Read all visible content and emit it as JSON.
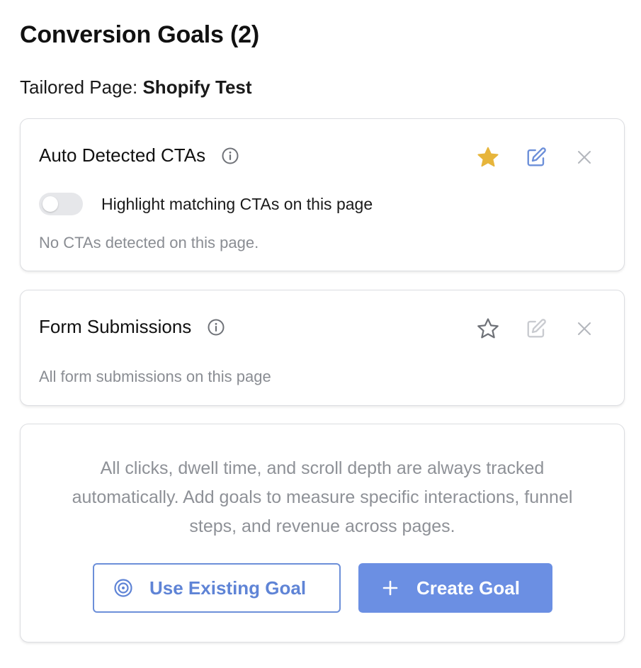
{
  "header": {
    "title": "Conversion Goals (2)",
    "page_label": "Tailored Page:",
    "page_name": "Shopify Test"
  },
  "cards": [
    {
      "title": "Auto Detected CTAs",
      "starred": true,
      "toggle_label": "Highlight matching CTAs on this page",
      "toggle_on": false,
      "note": "No CTAs detected on this page."
    },
    {
      "title": "Form Submissions",
      "starred": false,
      "note": "All form submissions on this page"
    }
  ],
  "info": {
    "text": "All clicks, dwell time, and scroll depth are always tracked automatically. Add goals to measure specific interactions, funnel steps, and revenue across pages.",
    "use_existing_label": "Use Existing Goal",
    "create_label": "Create Goal"
  },
  "colors": {
    "star_active": "#e7b53b",
    "accent": "#6b8fe3",
    "muted_text": "#8a8d93"
  },
  "icons": [
    "info-icon",
    "star-icon",
    "edit-icon",
    "close-icon",
    "target-icon",
    "plus-icon"
  ]
}
